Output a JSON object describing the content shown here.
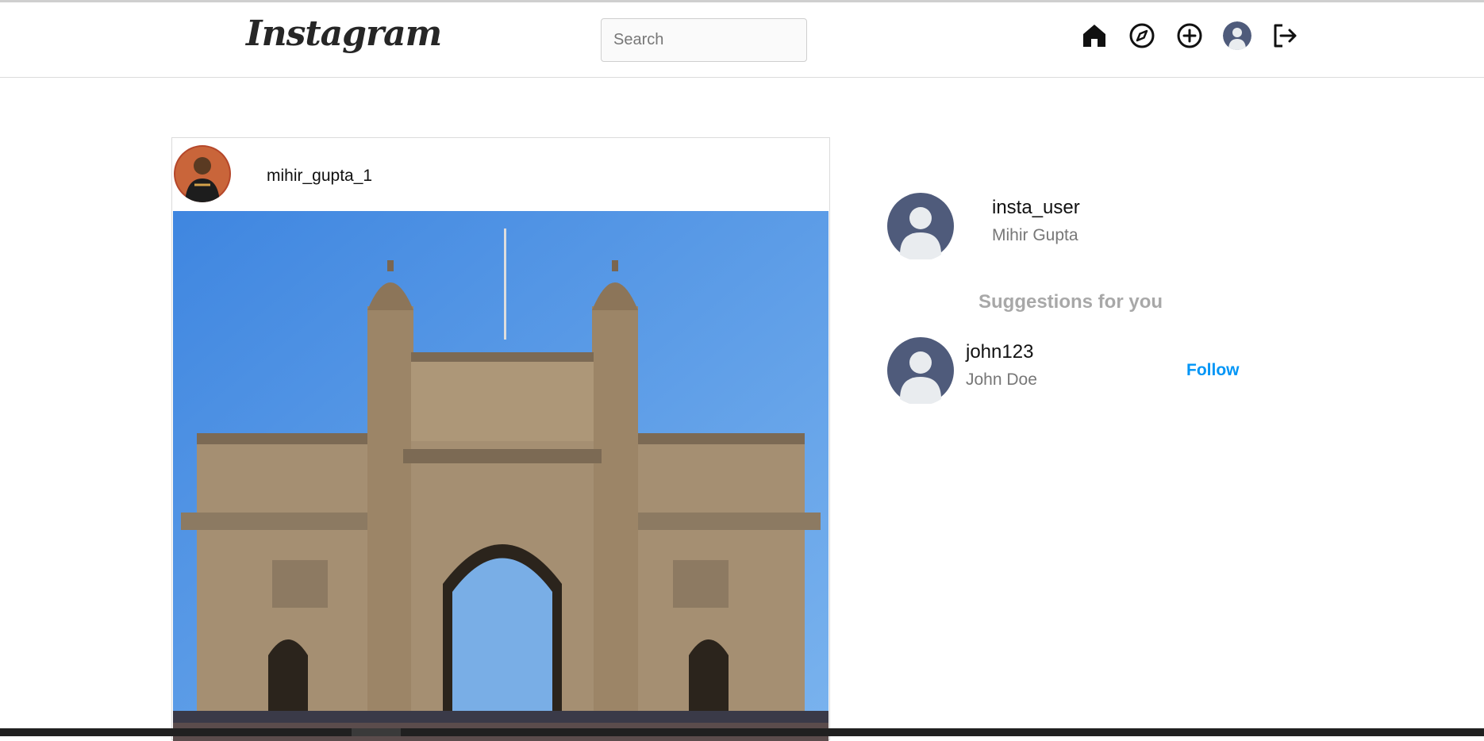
{
  "header": {
    "logo_text": "Instagram",
    "search": {
      "placeholder": "Search",
      "value": ""
    },
    "icons": [
      "home-icon",
      "explore-icon",
      "add-post-icon",
      "profile-avatar-icon",
      "logout-icon"
    ]
  },
  "post": {
    "username": "mihir_gupta_1",
    "image_subject": "Gateway of India"
  },
  "sidebar": {
    "username": "insta_user",
    "full_name": "Mihir Gupta",
    "suggestions_title": "Suggestions for you",
    "suggestions": [
      {
        "username": "john123",
        "full_name": "John Doe",
        "action": "Follow"
      }
    ]
  },
  "colors": {
    "follow": "#0095f6",
    "muted_text": "#777777",
    "suggestions_title": "#a8a8a8",
    "avatar_placeholder": "#4f5b7b"
  }
}
